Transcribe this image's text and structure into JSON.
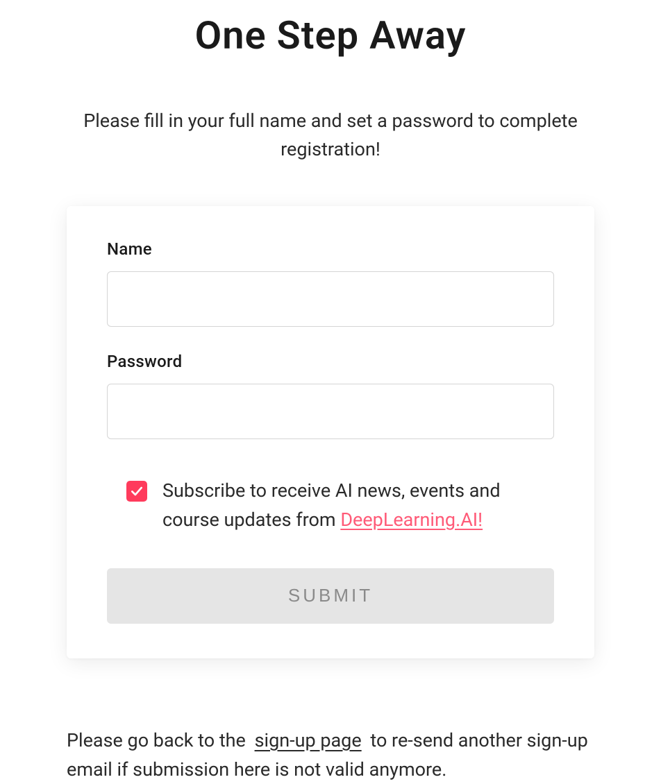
{
  "title": "One Step Away",
  "subtitle": "Please fill in your full name and set a password to complete registration!",
  "form": {
    "name_label": "Name",
    "name_value": "",
    "password_label": "Password",
    "password_value": "",
    "subscribe_checked": true,
    "subscribe_text_prefix": "Subscribe to receive AI news, events and course updates from ",
    "subscribe_link_text": "DeepLearning.AI!",
    "submit_label": "SUBMIT"
  },
  "footer": {
    "prefix": "Please go back to the ",
    "link_text": "sign-up page",
    "suffix": " to re-send another sign-up email if submission here is not valid anymore."
  },
  "colors": {
    "accent": "#ff3b5c",
    "link": "#ff5a77",
    "disabled_bg": "#e5e5e5",
    "disabled_text": "#8a8a8a"
  }
}
